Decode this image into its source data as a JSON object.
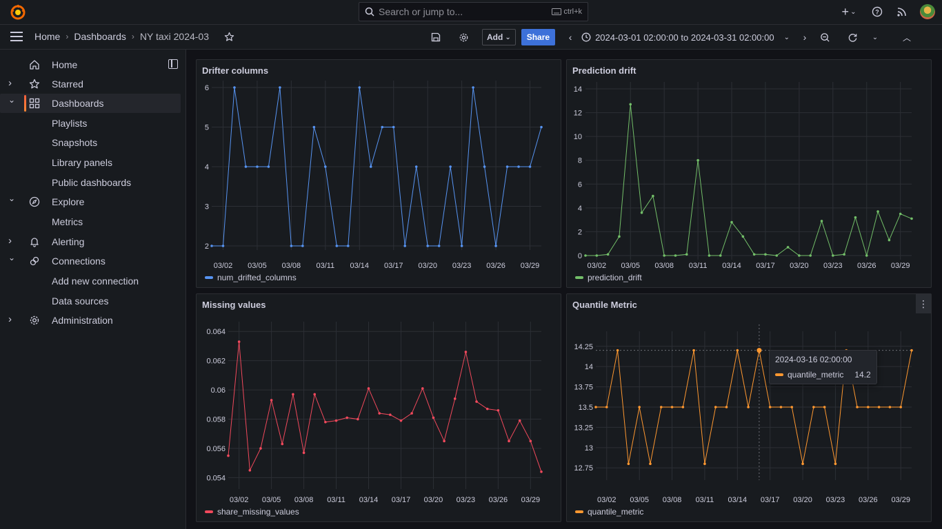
{
  "topbar": {
    "search_placeholder": "Search or jump to...",
    "search_shortcut": "ctrl+k",
    "icons": [
      "plus-icon",
      "help-icon",
      "news-icon",
      "avatar"
    ]
  },
  "navbar": {
    "breadcrumbs": [
      "Home",
      "Dashboards",
      "NY taxi 2024-03"
    ],
    "add_label": "Add",
    "share_label": "Share",
    "time_range": "2024-03-01 02:00:00 to 2024-03-31 02:00:00"
  },
  "sidebar": {
    "items": [
      {
        "label": "Home",
        "icon": "home-icon",
        "chevron": ""
      },
      {
        "label": "Starred",
        "icon": "star-icon",
        "chevron": "›"
      },
      {
        "label": "Dashboards",
        "icon": "apps-icon",
        "chevron": "⌄",
        "active": true
      },
      {
        "label": "Playlists",
        "sub": true
      },
      {
        "label": "Snapshots",
        "sub": true
      },
      {
        "label": "Library panels",
        "sub": true
      },
      {
        "label": "Public dashboards",
        "sub": true
      },
      {
        "label": "Explore",
        "icon": "compass-icon",
        "chevron": "⌄"
      },
      {
        "label": "Metrics",
        "sub": true
      },
      {
        "label": "Alerting",
        "icon": "bell-icon",
        "chevron": "›"
      },
      {
        "label": "Connections",
        "icon": "plug-icon",
        "chevron": "⌄"
      },
      {
        "label": "Add new connection",
        "sub": true
      },
      {
        "label": "Data sources",
        "sub": true
      },
      {
        "label": "Administration",
        "icon": "gear-icon",
        "chevron": "›"
      }
    ]
  },
  "colors": {
    "blue": "#5794f2",
    "green": "#73bf69",
    "red": "#f2495c",
    "orange": "#ff9830"
  },
  "chart_data": [
    {
      "type": "line",
      "title": "Drifter columns",
      "x_ticks": [
        "03/02",
        "03/05",
        "03/08",
        "03/11",
        "03/14",
        "03/17",
        "03/20",
        "03/23",
        "03/26",
        "03/29"
      ],
      "y_ticks": [
        "2",
        "3",
        "4",
        "5",
        "6"
      ],
      "ylim": [
        2,
        6
      ],
      "series": [
        {
          "name": "num_drifted_columns",
          "color": "#5794f2",
          "values": [
            2,
            2,
            6,
            4,
            4,
            4,
            6,
            2,
            2,
            5,
            4,
            2,
            2,
            6,
            4,
            5,
            5,
            2,
            4,
            2,
            2,
            4,
            2,
            6,
            4,
            2,
            4,
            4,
            4,
            5
          ]
        }
      ]
    },
    {
      "type": "line",
      "title": "Prediction drift",
      "x_ticks": [
        "03/02",
        "03/05",
        "03/08",
        "03/11",
        "03/14",
        "03/17",
        "03/20",
        "03/23",
        "03/26",
        "03/29"
      ],
      "y_ticks": [
        "0",
        "2",
        "4",
        "6",
        "8",
        "10",
        "12",
        "14"
      ],
      "ylim": [
        0,
        14
      ],
      "series": [
        {
          "name": "prediction_drift",
          "color": "#73bf69",
          "values": [
            0,
            0,
            0.1,
            1.6,
            12.7,
            3.6,
            5,
            0,
            0,
            0.1,
            8,
            0,
            0,
            2.8,
            1.6,
            0.1,
            0.1,
            0,
            0.7,
            0,
            0,
            2.9,
            0,
            0.1,
            3.2,
            0,
            3.7,
            1.3,
            3.5,
            3.1
          ]
        }
      ]
    },
    {
      "type": "line",
      "title": "Missing values",
      "x_ticks": [
        "03/02",
        "03/05",
        "03/08",
        "03/11",
        "03/14",
        "03/17",
        "03/20",
        "03/23",
        "03/26",
        "03/29"
      ],
      "y_ticks": [
        "0.054",
        "0.056",
        "0.058",
        "0.06",
        "0.062",
        "0.064"
      ],
      "ylim": [
        0.0535,
        0.0642
      ],
      "series": [
        {
          "name": "share_missing_values",
          "color": "#f2495c",
          "values": [
            0.0555,
            0.0633,
            0.0545,
            0.056,
            0.0593,
            0.0563,
            0.0597,
            0.0557,
            0.0597,
            0.0578,
            0.0579,
            0.0581,
            0.058,
            0.0601,
            0.0584,
            0.0583,
            0.0579,
            0.0584,
            0.0601,
            0.0581,
            0.0565,
            0.0594,
            0.0626,
            0.0592,
            0.0587,
            0.0586,
            0.0565,
            0.0579,
            0.0565,
            0.0544
          ]
        }
      ]
    },
    {
      "type": "line",
      "title": "Quantile Metric",
      "x_ticks": [
        "03/02",
        "03/05",
        "03/08",
        "03/11",
        "03/14",
        "03/17",
        "03/20",
        "03/23",
        "03/26",
        "03/29"
      ],
      "y_ticks": [
        "12.75",
        "13",
        "13.25",
        "13.5",
        "13.75",
        "14",
        "14.25"
      ],
      "ylim": [
        12.65,
        14.35
      ],
      "series": [
        {
          "name": "quantile_metric",
          "color": "#ff9830",
          "values": [
            13.5,
            13.5,
            14.2,
            12.8,
            13.5,
            12.8,
            13.5,
            13.5,
            13.5,
            14.2,
            12.8,
            13.5,
            13.5,
            14.2,
            13.5,
            14.2,
            13.5,
            13.5,
            13.5,
            12.8,
            13.5,
            13.5,
            12.8,
            14.2,
            13.5,
            13.5,
            13.5,
            13.5,
            13.5,
            14.2
          ]
        }
      ],
      "tooltip": {
        "time": "2024-03-16 02:00:00",
        "series": "quantile_metric",
        "value": "14.2"
      }
    }
  ]
}
